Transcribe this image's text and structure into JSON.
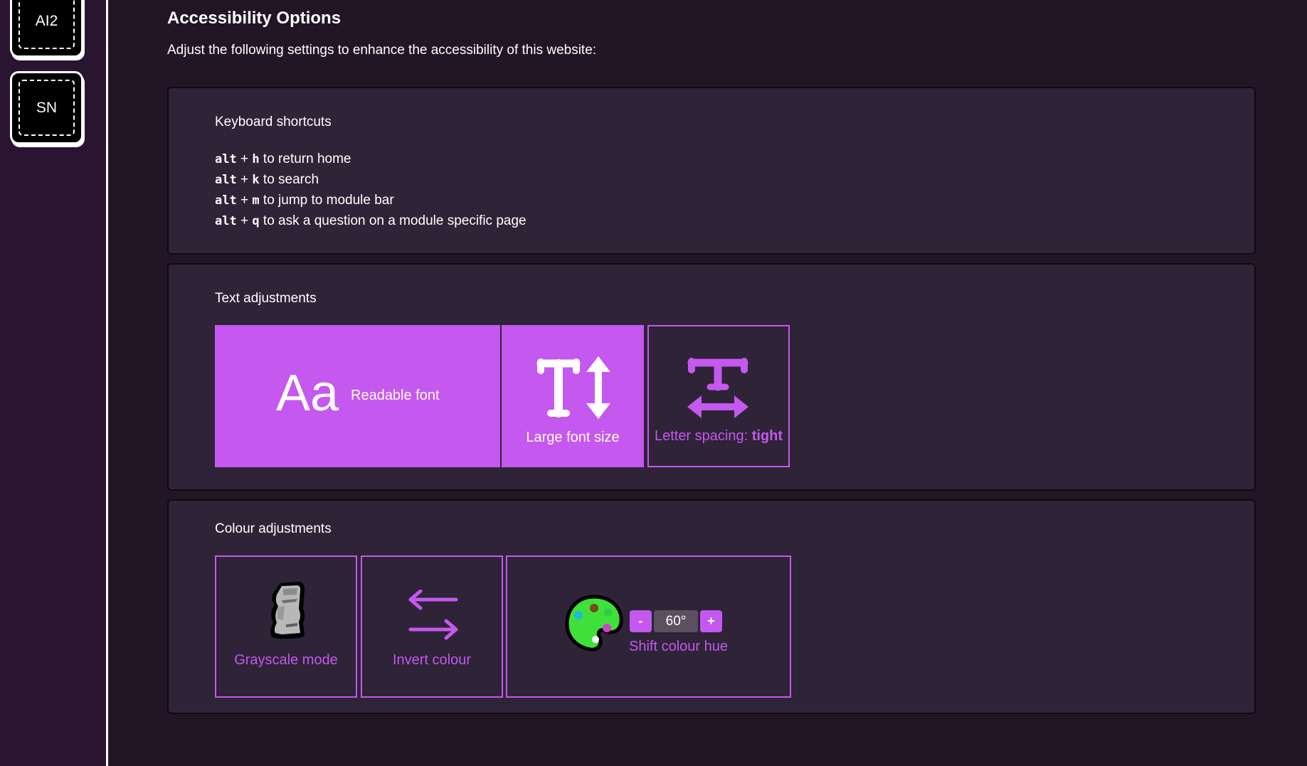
{
  "sidebar": {
    "modules": [
      {
        "label": "AI2"
      },
      {
        "label": "SN"
      }
    ]
  },
  "header": {
    "title": "Accessibility Options",
    "description": "Adjust the following settings to enhance the accessibility of this website:"
  },
  "keyboard": {
    "title": "Keyboard shortcuts",
    "shortcuts": [
      {
        "mod": "alt",
        "plus": "+",
        "key": "h",
        "text": "to return home"
      },
      {
        "mod": "alt",
        "plus": "+",
        "key": "k",
        "text": "to search"
      },
      {
        "mod": "alt",
        "plus": "+",
        "key": "m",
        "text": "to jump to module bar"
      },
      {
        "mod": "alt",
        "plus": "+",
        "key": "q",
        "text": "to ask a question on a module specific page"
      }
    ]
  },
  "text_adjust": {
    "title": "Text adjustments",
    "readable_glyph": "Aa",
    "readable_label": "Readable font",
    "large_label": "Large font size",
    "spacing_label": "Letter spacing:",
    "spacing_value": "tight"
  },
  "colour_adjust": {
    "title": "Colour adjustments",
    "grayscale_label": "Grayscale mode",
    "invert_label": "Invert colour",
    "hue_label": "Shift colour hue",
    "hue_minus": "-",
    "hue_plus": "+",
    "hue_value": "60°"
  },
  "colors": {
    "accent": "#c558ee",
    "background": "#221626",
    "panel": "#2e2337"
  },
  "icons": [
    "moai-icon",
    "palette-icon",
    "swap-arrows-icon",
    "text-height-icon",
    "letter-spacing-icon"
  ]
}
